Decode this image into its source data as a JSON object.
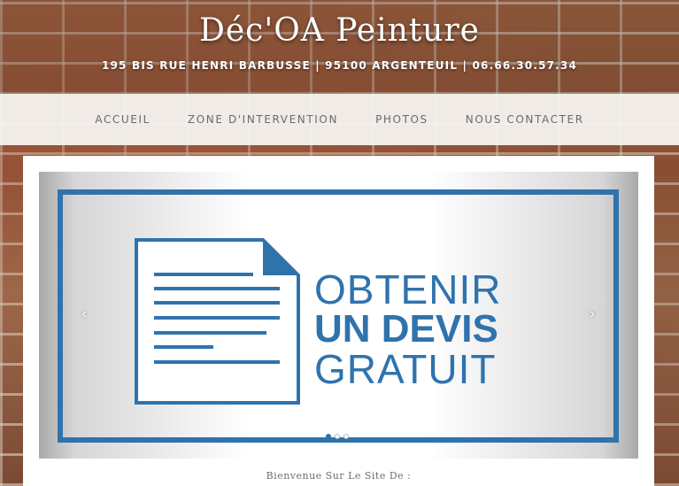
{
  "header": {
    "title": "Déc'OA Peinture",
    "subtitle": "195 BIS RUE HENRI BARBUSSE | 95100 ARGENTEUIL | 06.66.30.57.34"
  },
  "nav": {
    "items": [
      {
        "label": "ACCUEIL"
      },
      {
        "label": "ZONE D'INTERVENTION"
      },
      {
        "label": "PHOTOS"
      },
      {
        "label": "NOUS CONTACTER"
      }
    ]
  },
  "slider": {
    "banner": {
      "line1": "OBTENIR",
      "line2": "UN DEVIS",
      "line3": "GRATUIT",
      "color": "#2f73ad",
      "icon": "document-icon"
    },
    "prev_icon": "‹",
    "next_icon": "›",
    "dot_count": 3,
    "active_dot": 1
  },
  "welcome": {
    "text": "Bienvenue Sur Le Site De :"
  }
}
